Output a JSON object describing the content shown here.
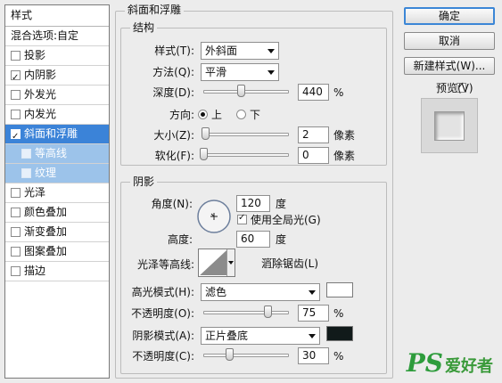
{
  "style_list": {
    "header": "样式",
    "blend_options": "混合选项:自定",
    "items": [
      {
        "label": "投影",
        "checked": false
      },
      {
        "label": "内阴影",
        "checked": true
      },
      {
        "label": "外发光",
        "checked": false
      },
      {
        "label": "内发光",
        "checked": false
      },
      {
        "label": "斜面和浮雕",
        "checked": true,
        "selected": true
      },
      {
        "label": "等高线",
        "checked": false,
        "sub": true
      },
      {
        "label": "纹理",
        "checked": false,
        "sub": true
      },
      {
        "label": "光泽",
        "checked": false
      },
      {
        "label": "颜色叠加",
        "checked": false
      },
      {
        "label": "渐变叠加",
        "checked": false
      },
      {
        "label": "图案叠加",
        "checked": false
      },
      {
        "label": "描边",
        "checked": false
      }
    ]
  },
  "bevel": {
    "title": "斜面和浮雕",
    "structure": {
      "title": "结构",
      "style_label": "样式(T):",
      "style_value": "外斜面",
      "technique_label": "方法(Q):",
      "technique_value": "平滑",
      "depth_label": "深度(D):",
      "depth_value": "440",
      "depth_unit": "%",
      "depth_fraction": 0.44,
      "direction_label": "方向:",
      "direction_up": "上",
      "direction_down": "下",
      "size_label": "大小(Z):",
      "size_value": "2",
      "size_unit": "像素",
      "size_fraction": 0.02,
      "soften_label": "软化(F):",
      "soften_value": "0",
      "soften_unit": "像素",
      "soften_fraction": 0.0
    },
    "shading": {
      "title": "阴影",
      "angle_label": "角度(N):",
      "angle_value": "120",
      "angle_unit": "度",
      "global_light_label": "使用全局光(G)",
      "global_light_checked": true,
      "altitude_label": "高度:",
      "altitude_value": "60",
      "altitude_unit": "度",
      "gloss_contour_label": "光泽等高线:",
      "anti_aliased_label": "消除锯齿(L)",
      "anti_aliased_checked": false,
      "highlight_mode_label": "高光模式(H):",
      "highlight_mode_value": "滤色",
      "highlight_color": "#ffffff",
      "highlight_opacity_label": "不透明度(O):",
      "highlight_opacity_value": "75",
      "highlight_opacity_unit": "%",
      "highlight_opacity_fraction": 0.75,
      "shadow_mode_label": "阴影模式(A):",
      "shadow_mode_value": "正片叠底",
      "shadow_color": "#111a1a",
      "shadow_opacity_label": "不透明度(C):",
      "shadow_opacity_value": "30",
      "shadow_opacity_unit": "%",
      "shadow_opacity_fraction": 0.3
    }
  },
  "buttons": {
    "ok": "确定",
    "cancel": "取消",
    "new_style": "新建样式(W)...",
    "preview_label": "预览(V)",
    "preview_checked": true
  },
  "watermark": {
    "ps": "PS",
    "cn": "爱好者"
  },
  "colors": {
    "selection": "#3b83d8",
    "sub_selection": "#9cc3ea",
    "default_button_border": "#3b86d6",
    "watermark": "#2e9c3c"
  }
}
